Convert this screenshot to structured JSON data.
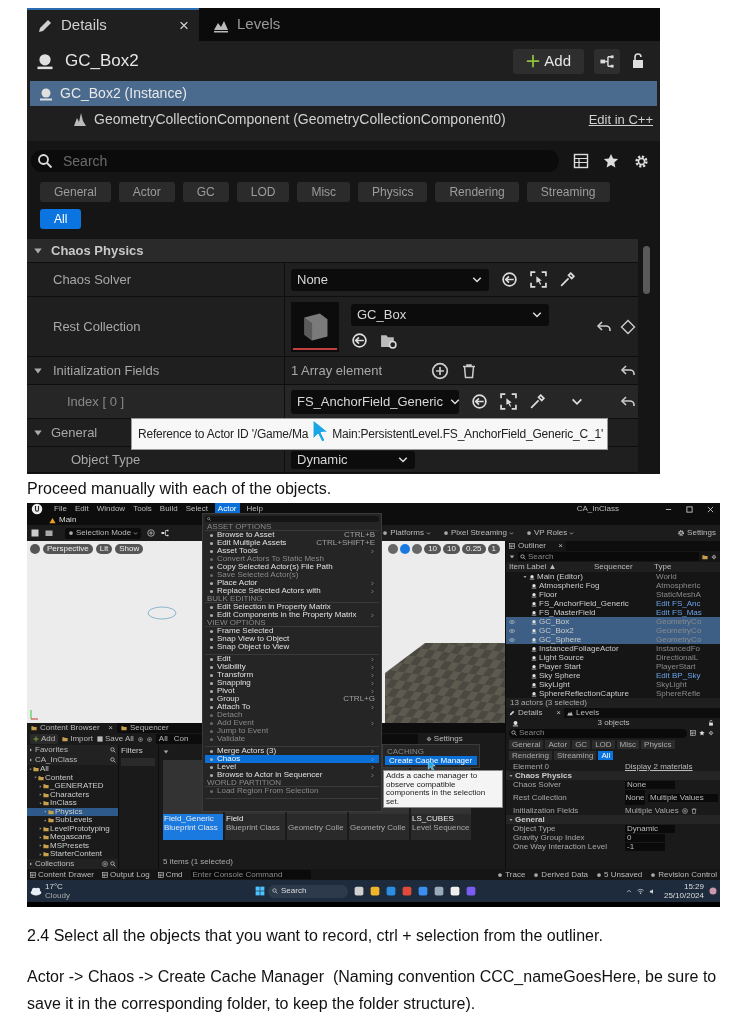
{
  "details_capture": {
    "tabs": [
      {
        "label": "Details",
        "selected": true,
        "close": "×"
      },
      {
        "label": "Levels",
        "selected": false
      }
    ],
    "actor": {
      "name": "GC_Box2",
      "add_button": "Add"
    },
    "components": [
      {
        "label": "GC_Box2 (Instance)",
        "selected": true,
        "children": [
          {
            "label": "GeometryCollectionComponent (GeometryCollectionComponent0)",
            "selected": false,
            "link": "Edit in C++"
          }
        ]
      }
    ],
    "search": {
      "placeholder": "Search"
    },
    "filters": [
      {
        "label": "General",
        "selected": false
      },
      {
        "label": "Actor",
        "selected": false
      },
      {
        "label": "GC",
        "selected": false
      },
      {
        "label": "LOD",
        "selected": false
      },
      {
        "label": "Misc",
        "selected": false
      },
      {
        "label": "Physics",
        "selected": false
      },
      {
        "label": "Rendering",
        "selected": false
      },
      {
        "label": "Streaming",
        "selected": false
      },
      {
        "label": "All",
        "selected": true
      }
    ],
    "sections": [
      {
        "title": "Chaos Physics",
        "expanded": true,
        "properties": [
          {
            "label": "Chaos Solver",
            "kind": "dropdown",
            "value": "None",
            "modified": false
          },
          {
            "label": "Rest Collection",
            "kind": "asset",
            "value": "GC_Box",
            "modified": true
          },
          {
            "label": "Initialization Fields",
            "kind": "array",
            "value": "1 Array element",
            "modified": true,
            "expanded": true,
            "children": [
              {
                "label": "Index [ 0 ]",
                "kind": "dropdown",
                "value": "FS_AnchorField_Generic",
                "modified": true
              }
            ]
          }
        ]
      },
      {
        "title": "General",
        "expanded": true,
        "properties": [
          {
            "label": "Object Type",
            "kind": "dropdown",
            "value": "Dynamic",
            "modified": false
          }
        ]
      }
    ],
    "tooltip": [
      "Reference to Actor ID '/Game/Ma",
      "Main:PersistentLevel.FS_AnchorField_Generic_C_1'"
    ]
  },
  "caption": "Proceed manually with each of the objects.",
  "editor_capture": {
    "menu": [
      {
        "label": "File",
        "selected": false
      },
      {
        "label": "Edit",
        "selected": false
      },
      {
        "label": "Window",
        "selected": false
      },
      {
        "label": "Tools",
        "selected": false
      },
      {
        "label": "Build",
        "selected": false
      },
      {
        "label": "Select",
        "selected": false
      },
      {
        "label": "Actor",
        "selected": true
      },
      {
        "label": "Help",
        "selected": false
      }
    ],
    "window_title": "CA_InClass",
    "level_tab": "Main",
    "toolbar": [
      "Selection Mode",
      "Platforms",
      "Pixel Streaming",
      "VP Roles"
    ],
    "settings": "Settings",
    "viewport": {
      "buttons": [
        "Perspective",
        "Lit",
        "Show"
      ],
      "snap_values": [
        "10",
        "10",
        "0.25",
        "1"
      ]
    },
    "actor_menu": [
      {
        "kind": "header",
        "label": "ASSET OPTIONS"
      },
      {
        "kind": "item",
        "label": "Browse to Asset",
        "shortcut": "CTRL+B",
        "submenu": false,
        "disabled": false,
        "selected": false
      },
      {
        "kind": "item",
        "label": "Edit Multiple Assets",
        "shortcut": "CTRL+SHIFT+E",
        "submenu": false,
        "disabled": false,
        "selected": false
      },
      {
        "kind": "item",
        "label": "Asset Tools",
        "submenu": true,
        "disabled": false,
        "selected": false
      },
      {
        "kind": "item",
        "label": "Convert Actors To Static Mesh",
        "submenu": false,
        "disabled": true,
        "selected": false
      },
      {
        "kind": "item",
        "label": "Copy Selected Actor(s) File Path",
        "submenu": false,
        "disabled": false,
        "selected": false
      },
      {
        "kind": "item",
        "label": "Save Selected Actor(s)",
        "submenu": false,
        "disabled": true,
        "selected": false
      },
      {
        "kind": "item",
        "label": "Place Actor",
        "submenu": true,
        "disabled": false,
        "selected": false
      },
      {
        "kind": "item",
        "label": "Replace Selected Actors with",
        "submenu": true,
        "disabled": false,
        "selected": false
      },
      {
        "kind": "header",
        "label": "BULK EDITING"
      },
      {
        "kind": "item",
        "label": "Edit Selection in Property Matrix",
        "submenu": false,
        "disabled": false,
        "selected": false
      },
      {
        "kind": "item",
        "label": "Edit Components in the Property Matrix",
        "submenu": true,
        "disabled": false,
        "selected": false
      },
      {
        "kind": "header",
        "label": "VIEW OPTIONS"
      },
      {
        "kind": "item",
        "label": "Frame Selected",
        "submenu": false,
        "disabled": false,
        "selected": false
      },
      {
        "kind": "item",
        "label": "Snap View to Object",
        "submenu": false,
        "disabled": false,
        "selected": false
      },
      {
        "kind": "item",
        "label": "Snap Object to View",
        "submenu": false,
        "disabled": false,
        "selected": false
      },
      {
        "kind": "divider"
      },
      {
        "kind": "item",
        "label": "Edit",
        "submenu": true,
        "disabled": false,
        "selected": false
      },
      {
        "kind": "item",
        "label": "Visibility",
        "submenu": true,
        "disabled": false,
        "selected": false
      },
      {
        "kind": "item",
        "label": "Transform",
        "submenu": true,
        "disabled": false,
        "selected": false
      },
      {
        "kind": "item",
        "label": "Snapping",
        "submenu": true,
        "disabled": false,
        "selected": false
      },
      {
        "kind": "item",
        "label": "Pivot",
        "submenu": true,
        "disabled": false,
        "selected": false
      },
      {
        "kind": "item",
        "label": "Group",
        "shortcut": "CTRL+G",
        "submenu": false,
        "disabled": false,
        "selected": false
      },
      {
        "kind": "item",
        "label": "Attach To",
        "submenu": true,
        "disabled": false,
        "selected": false
      },
      {
        "kind": "item",
        "label": "Detach",
        "submenu": false,
        "disabled": true,
        "selected": false
      },
      {
        "kind": "item",
        "label": "Add Event",
        "submenu": true,
        "disabled": true,
        "selected": false
      },
      {
        "kind": "item",
        "label": "Jump to Event",
        "submenu": false,
        "disabled": true,
        "selected": false
      },
      {
        "kind": "item",
        "label": "Validate",
        "submenu": false,
        "disabled": true,
        "selected": false
      },
      {
        "kind": "divider"
      },
      {
        "kind": "item",
        "label": "Merge Actors (3)",
        "submenu": true,
        "disabled": false,
        "selected": false
      },
      {
        "kind": "item",
        "label": "Chaos",
        "submenu": true,
        "disabled": false,
        "selected": true
      },
      {
        "kind": "item",
        "label": "Level",
        "submenu": true,
        "disabled": false,
        "selected": false
      },
      {
        "kind": "item",
        "label": "Browse to Actor in Sequencer",
        "submenu": true,
        "disabled": false,
        "selected": false
      },
      {
        "kind": "header",
        "label": "WORLD PARTITION"
      },
      {
        "kind": "item",
        "label": "Load Region From Selection",
        "submenu": false,
        "disabled": true,
        "selected": false
      },
      {
        "kind": "divider"
      }
    ],
    "submenu": {
      "header": "CACHING",
      "items": [
        {
          "label": "Create Cache Manager",
          "selected": true
        }
      ]
    },
    "menu_tooltip": "Adds a cache manager to observe compatible components in the selection set.",
    "outliner": {
      "tab": "Outliner",
      "close": "×",
      "search": "Search",
      "columns": [
        "Item Label ▲",
        "Sequencer",
        "Type"
      ],
      "rows": [
        {
          "label": "Main (Editor)",
          "type": "World",
          "type_link": false,
          "selected": false,
          "expanded": true,
          "children": [
            {
              "label": "Atmospheric Fog",
              "type": "Atmospheric",
              "type_link": false,
              "selected": false
            },
            {
              "label": "Floor",
              "type": "StaticMeshA",
              "type_link": false,
              "selected": false
            },
            {
              "label": "FS_AnchorField_Generic",
              "type": "Edit FS_Anc",
              "type_link": true,
              "selected": false
            },
            {
              "label": "FS_MasterField",
              "type": "Edit FS_Mas",
              "type_link": true,
              "selected": false
            },
            {
              "label": "GC_Box",
              "type": "GeometryCo",
              "type_link": false,
              "selected": true
            },
            {
              "label": "GC_Box2",
              "type": "GeometryCo",
              "type_link": false,
              "selected": true
            },
            {
              "label": "GC_Sphere",
              "type": "GeometryCo",
              "type_link": false,
              "selected": true
            },
            {
              "label": "InstancedFoliageActor",
              "type": "InstancedFo",
              "type_link": false,
              "selected": false
            },
            {
              "label": "Light Source",
              "type": "DirectionalL",
              "type_link": false,
              "selected": false
            },
            {
              "label": "Player Start",
              "type": "PlayerStart",
              "type_link": false,
              "selected": false
            },
            {
              "label": "Sky Sphere",
              "type": "Edit BP_Sky",
              "type_link": true,
              "selected": false
            },
            {
              "label": "SkyLight",
              "type": "SkyLight",
              "type_link": false,
              "selected": false
            },
            {
              "label": "SphereReflectionCapture",
              "type": "SphereRefle",
              "type_link": false,
              "selected": false
            }
          ]
        }
      ],
      "footer": "13 actors (3 selected)"
    },
    "details": {
      "tabs": [
        {
          "label": "Details",
          "selected": true,
          "close": "×"
        },
        {
          "label": "Levels",
          "selected": false
        }
      ],
      "title": "3 objects",
      "search": "Search",
      "filters": [
        {
          "label": "General",
          "selected": false
        },
        {
          "label": "Actor",
          "selected": false
        },
        {
          "label": "GC",
          "selected": false
        },
        {
          "label": "LOD",
          "selected": false
        },
        {
          "label": "Misc",
          "selected": false
        },
        {
          "label": "Physics",
          "selected": false
        },
        {
          "label": "Rendering",
          "selected": false
        },
        {
          "label": "Streaming",
          "selected": false
        },
        {
          "label": "All",
          "selected": true
        }
      ],
      "rows": [
        {
          "kind": "link",
          "label": "Element 0",
          "value": "Display 2 materials"
        },
        {
          "kind": "section",
          "label": "Chaos Physics"
        },
        {
          "kind": "dropdown",
          "label": "Chaos Solver",
          "value": "None"
        },
        {
          "kind": "asset",
          "label": "Rest Collection",
          "thumbnail": "None",
          "value": "Multiple Values"
        },
        {
          "kind": "array",
          "label": "Initialization Fields",
          "value": "Multiple Values"
        },
        {
          "kind": "section",
          "label": "General"
        },
        {
          "kind": "dropdown",
          "label": "Object Type",
          "value": "Dynamic"
        },
        {
          "kind": "input",
          "label": "Gravity Group Index",
          "value": "0"
        },
        {
          "kind": "input",
          "label": "One Way Interaction Level",
          "value": "-1"
        }
      ]
    },
    "content_browser": {
      "tabs": [
        {
          "label": "Content Browser",
          "selected": true,
          "close": "×"
        },
        {
          "label": "Sequencer",
          "selected": false
        }
      ],
      "add_button": "Add",
      "import_button": "Import",
      "save_button": "Save All",
      "path": [
        "All",
        "Con"
      ],
      "settings": "Settings",
      "favorites": "Favorites",
      "project": "CA_InClass",
      "tree": [
        {
          "label": "All",
          "selected": false,
          "children": [
            {
              "label": "Content",
              "selected": false,
              "children": [
                {
                  "label": "_GENERATED",
                  "selected": false
                },
                {
                  "label": "Characters",
                  "selected": false
                },
                {
                  "label": "InClass",
                  "selected": false,
                  "children": [
                    {
                      "label": "Physics",
                      "selected": true
                    },
                    {
                      "label": "SubLevels",
                      "selected": false
                    }
                  ]
                },
                {
                  "label": "LevelPrototyping",
                  "selected": false
                },
                {
                  "label": "Megascans",
                  "selected": false
                },
                {
                  "label": "MSPresets",
                  "selected": false
                },
                {
                  "label": "StarterContent",
                  "selected": false
                }
              ]
            }
          ]
        }
      ],
      "collections": "Collections",
      "filters": "Filters",
      "assets": [
        {
          "name": "Field_Generic",
          "type": "Blueprint Class",
          "selected": true
        },
        {
          "name": "Field",
          "type": "Blueprint Class",
          "selected": false
        },
        {
          "type": "Geometry Colle",
          "selected": false
        },
        {
          "type": "Geometry Colle",
          "selected": false
        },
        {
          "name": "LS_CUBES",
          "type": "Level Sequence",
          "selected": false
        }
      ],
      "status": "5 items (1 selected)"
    },
    "status_bar": {
      "left": [
        "Content Drawer",
        "Output Log",
        "Cmd"
      ],
      "console_placeholder": "Enter Console Command",
      "right": [
        "Trace",
        "Derived Data",
        "5 Unsaved",
        "Revision Control"
      ]
    },
    "taskbar": {
      "temperature": "17°C",
      "weather": "Cloudy",
      "search": "Search",
      "time": "15:29",
      "date": "25/10/2024"
    }
  },
  "step": "2.4 Select all the objects that you want to record, ctrl + selection from the outliner.",
  "instruction": "Actor -> Chaos -> Create Cache Manager  (Naming convention CCC_nameGoesHere, be sure to save it in the corresponding folder, to keep the folder structure)."
}
